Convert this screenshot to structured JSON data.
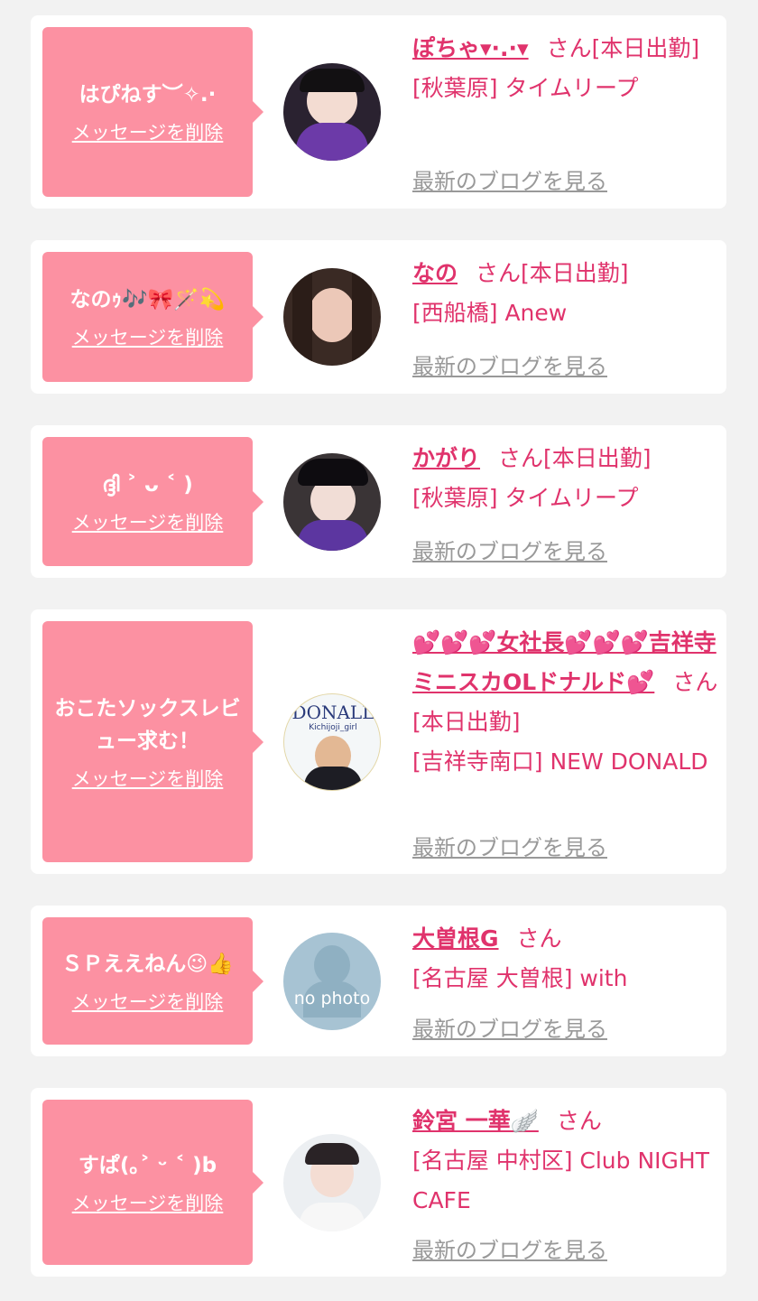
{
  "common": {
    "delete_label": "メッセージを削除",
    "blog_label": "最新のブログを見る",
    "san": "さん"
  },
  "cards": [
    {
      "message": "はぴねす︶✧.·",
      "name": "ぽちゃ▾·.·▾",
      "status": "[本日出勤]",
      "shop": "[秋葉原] タイムリープ",
      "avatar": "photo"
    },
    {
      "message": "なのｩ🎶🎀🪄💫",
      "name": "なの",
      "status": "[本日出勤]",
      "shop": "[西船橋] Anew",
      "avatar": "photo"
    },
    {
      "message": "ദ്ദി ˃ ᴗ ˂ )",
      "name": "かがり",
      "status": "[本日出勤]",
      "shop": "[秋葉原] タイムリープ",
      "avatar": "photo"
    },
    {
      "message": "おこたソックスレビュー求む！",
      "name": "💕💕💕女社長💕💕💕吉祥寺ミニスカOLドナルド💕",
      "status": "[本日出勤]",
      "shop": "[吉祥寺南口] NEW DONALD",
      "avatar": "logo",
      "avatar_text": "DONALL",
      "avatar_subtext": "Kichijoji_girl"
    },
    {
      "message": "ＳＰええねん😉👍",
      "name": "大曽根G",
      "status": "",
      "shop": "[名古屋 大曽根] with",
      "avatar": "no-photo",
      "avatar_text": "no photo"
    },
    {
      "message": "すぱ(｡˃ ᵕ ˂ )b",
      "name": "鈴宮 一華🪽",
      "status": "",
      "shop": "[名古屋 中村区] Club NIGHT CAFE",
      "avatar": "photo"
    }
  ],
  "colors": {
    "background": "#f2f2f2",
    "bubble": "#fc91a2",
    "name": "#e0336c",
    "link_gray": "#999999"
  }
}
